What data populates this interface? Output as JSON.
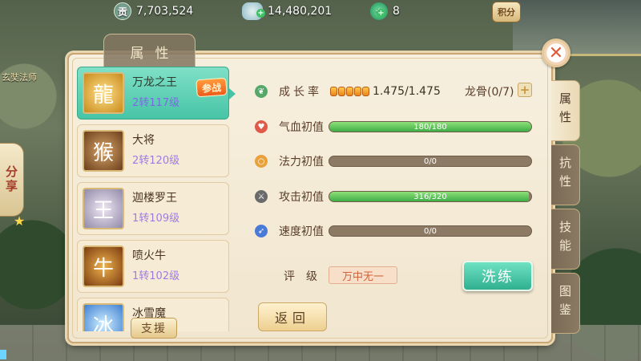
{
  "resources": {
    "coin": {
      "icon": "gong-coin-icon",
      "value": "7,703,524"
    },
    "silver": {
      "icon": "silver-ingot-icon",
      "value": "14,480,201"
    },
    "jade": {
      "icon": "jade-icon",
      "value": "8"
    },
    "points_button": "积分"
  },
  "background_hint": "玄奘法师",
  "share": {
    "label": "分享"
  },
  "panel": {
    "header_tab": "属性",
    "close_icon": "close-icon"
  },
  "pets": [
    {
      "name": "万龙之王",
      "level": "2转117级",
      "avatar": "golden-dragon-warrior",
      "active": true,
      "badge": "参战"
    },
    {
      "name": "大将",
      "level": "2转120级",
      "avatar": "monkey-general",
      "active": false
    },
    {
      "name": "迦楼罗王",
      "level": "1转109级",
      "avatar": "silver-hair-warrior",
      "active": false
    },
    {
      "name": "喷火牛",
      "level": "1转102级",
      "avatar": "fire-bull",
      "active": false
    },
    {
      "name": "冰雪魔",
      "level": "",
      "avatar": "ice-demon",
      "active": false
    }
  ],
  "support_button": "支援",
  "stats": {
    "growth": {
      "label": "成长率",
      "value": "1.475/1.475",
      "stones": 5
    },
    "dragon_bone": {
      "label": "龙骨(0/7)"
    },
    "hp": {
      "label": "气血初值",
      "value": "180/180",
      "ratio": 1.0
    },
    "mp": {
      "label": "法力初值",
      "value": "0/0",
      "ratio": 0.0
    },
    "attack": {
      "label": "攻击初值",
      "value": "316/320",
      "ratio": 0.9875
    },
    "speed": {
      "label": "速度初值",
      "value": "0/0",
      "ratio": 0.0
    }
  },
  "rating": {
    "label": "评级",
    "value": "万中无一"
  },
  "wash_button": "洗练",
  "back_button": "返回",
  "side_tabs": [
    "属性",
    "抗性",
    "技能",
    "图鉴"
  ],
  "colors": {
    "accent_teal": "#47c4a6",
    "bar_fill_green": "#3fae46",
    "fight_badge_orange": "#ef5b19",
    "close_red": "#e15b3a"
  }
}
